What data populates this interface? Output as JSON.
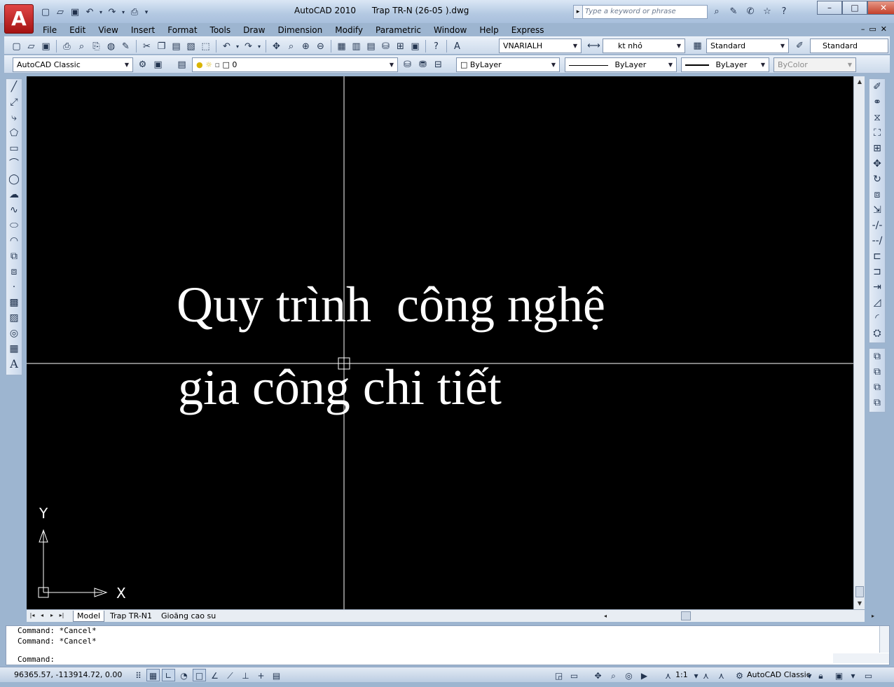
{
  "app": {
    "logo_letter": "A",
    "title": "AutoCAD 2010      Trap TR-N (26-05 ).dwg",
    "search_placeholder": "Type a keyword or phrase",
    "window_controls": [
      "–",
      "□",
      "✕"
    ],
    "doc_controls": [
      "–",
      "▭",
      "✕"
    ]
  },
  "menu": [
    "File",
    "Edit",
    "View",
    "Insert",
    "Format",
    "Tools",
    "Draw",
    "Dimension",
    "Modify",
    "Parametric",
    "Window",
    "Help",
    "Express"
  ],
  "toolbar1": {
    "text_style": "VNARIALH",
    "dim_style": "kt nhỏ",
    "table_style": "Standard",
    "multileader_style": "Standard"
  },
  "toolbar2": {
    "workspace": "AutoCAD Classic",
    "layer": "0",
    "color": "ByLayer",
    "linetype": "ByLayer",
    "lineweight": "ByLayer",
    "plotstyle": "ByColor"
  },
  "drawing": {
    "line1": "Quy trình  công nghệ",
    "line2": "gia công chi tiết",
    "ucs_x": "X",
    "ucs_y": "Y"
  },
  "layout_tabs": [
    "Model",
    "Trap TR-N1",
    "Gioăng cao su"
  ],
  "command": {
    "history": [
      "Command: *Cancel*",
      "Command: *Cancel*"
    ],
    "prompt": "Command:"
  },
  "status": {
    "coords": "96365.57, -113914.72, 0.00",
    "annotation_scale": "1:1",
    "workspace": "AutoCAD Classic"
  },
  "colors": {
    "canvas": "#000000",
    "drawing_text": "#ffffff",
    "crosshair": "#ffffff",
    "close_button": "#c4402a"
  }
}
